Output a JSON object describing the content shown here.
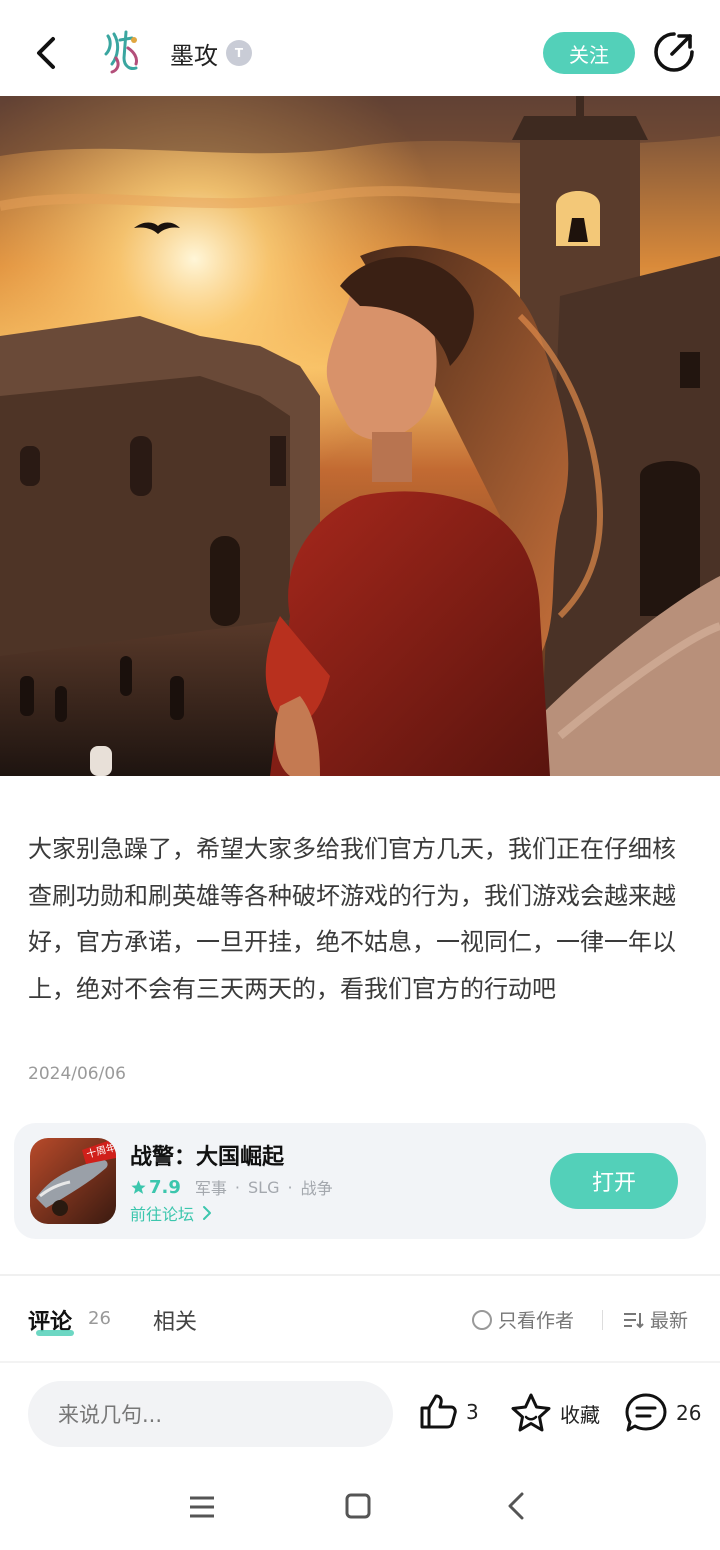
{
  "header": {
    "author_name": "墨攻",
    "level_badge": "T",
    "follow_label": "关注"
  },
  "post": {
    "text": "大家别急躁了，希望大家多给我们官方几天，我们正在仔细核查刷功勋和刷英雄等各种破坏游戏的行为，我们游戏会越来越好，官方承诺，一旦开挂，绝不姑息，一视同仁，一律一年以上，绝对不会有三天两天的，看我们官方的行动吧",
    "date": "2024/06/06"
  },
  "game_card": {
    "title": "战警：大国崛起",
    "rating": "7.9",
    "tags": [
      "军事",
      "SLG",
      "战争"
    ],
    "forum_link": "前往论坛",
    "open_label": "打开",
    "icon_badge": "十周年"
  },
  "tabs": {
    "comments_label": "评论",
    "comments_count": "26",
    "related_label": "相关",
    "author_only_label": "只看作者",
    "sort_label": "最新"
  },
  "action_bar": {
    "input_placeholder": "来说几句...",
    "like_count": "3",
    "favorite_label": "收藏",
    "comment_count": "26"
  },
  "colors": {
    "accent": "#53d0b9",
    "accent_text": "#3cc6ad"
  }
}
